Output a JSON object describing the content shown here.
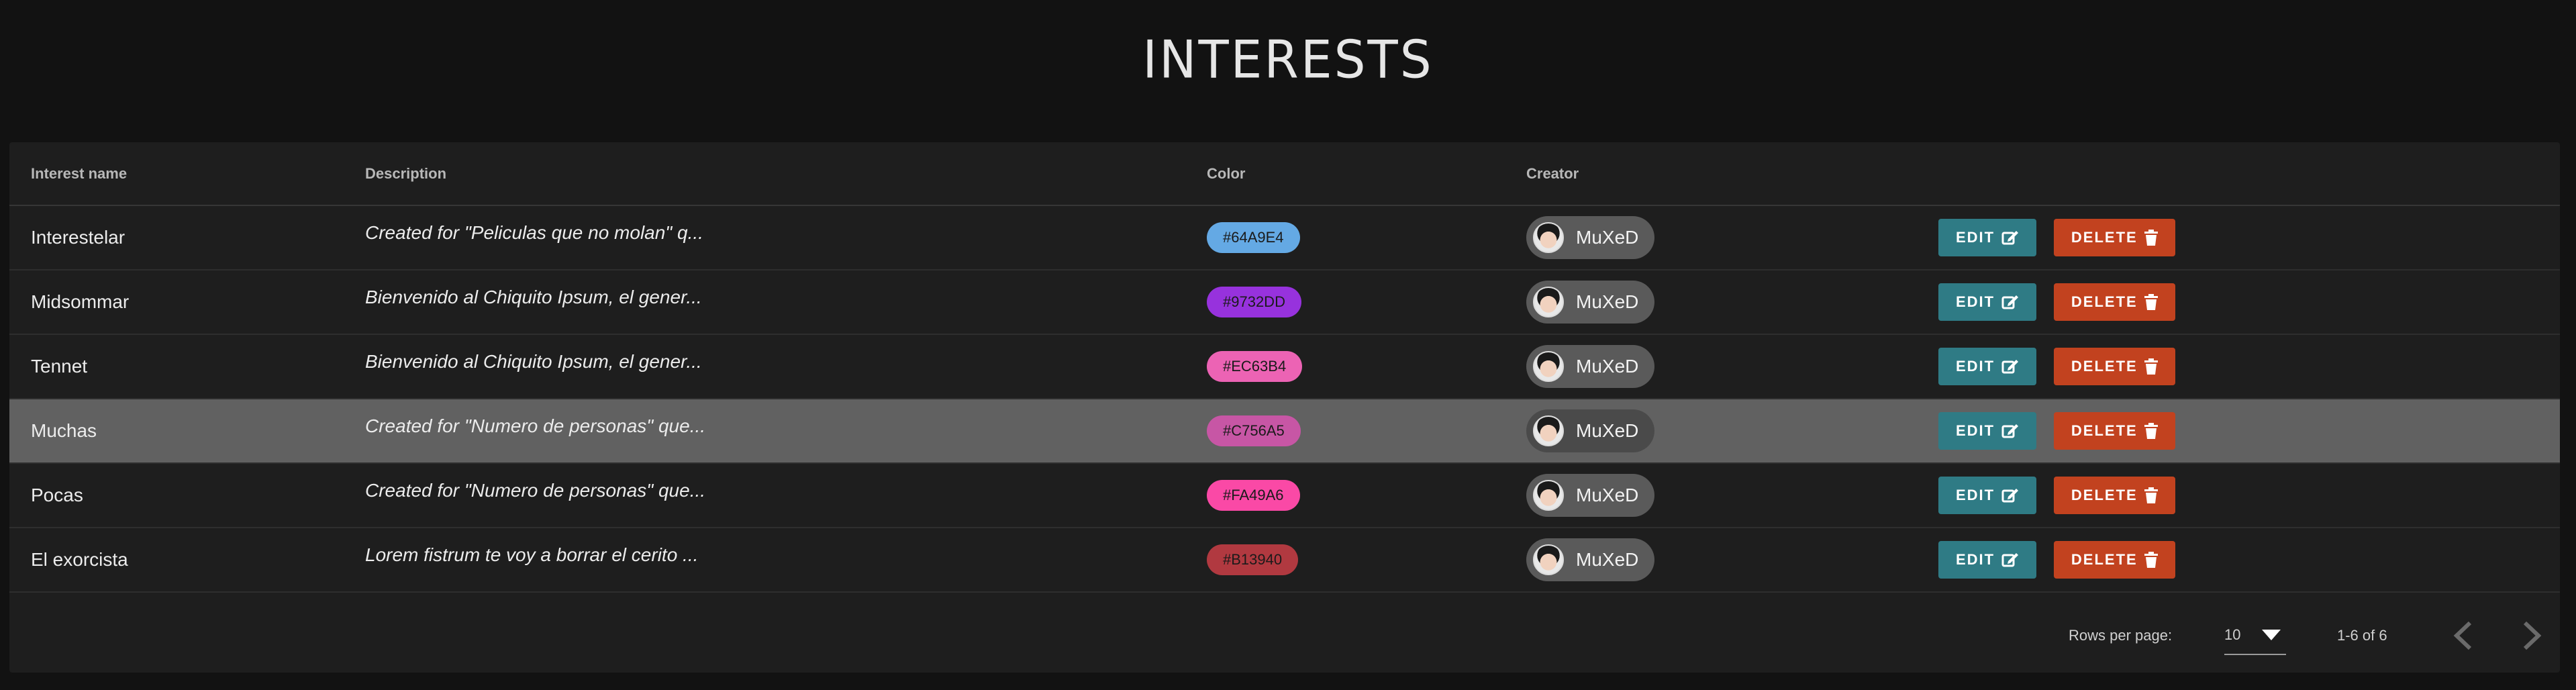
{
  "page": {
    "title": "INTERESTS"
  },
  "table": {
    "columns": [
      "Interest name",
      "Description",
      "Color",
      "Creator"
    ],
    "rows": [
      {
        "name": "Interestelar",
        "description": "Created for \"Peliculas que no molan\" q...",
        "color": "#64A9E4",
        "creator": "MuXeD",
        "edit": "EDIT",
        "delete": "DELETE"
      },
      {
        "name": "Midsommar",
        "description": "Bienvenido al Chiquito Ipsum, el gener...",
        "color": "#9732DD",
        "creator": "MuXeD",
        "edit": "EDIT",
        "delete": "DELETE"
      },
      {
        "name": "Tennet",
        "description": "Bienvenido al Chiquito Ipsum, el gener...",
        "color": "#EC63B4",
        "creator": "MuXeD",
        "edit": "EDIT",
        "delete": "DELETE"
      },
      {
        "name": "Muchas",
        "description": "Created for \"Numero de personas\" que...",
        "color": "#C756A5",
        "creator": "MuXeD",
        "edit": "EDIT",
        "delete": "DELETE",
        "selected": true
      },
      {
        "name": "Pocas",
        "description": "Created for \"Numero de personas\" que...",
        "color": "#FA49A6",
        "creator": "MuXeD",
        "edit": "EDIT",
        "delete": "DELETE"
      },
      {
        "name": "El exorcista",
        "description": "Lorem fistrum te voy a borrar el cerito ...",
        "color": "#B13940",
        "creator": "MuXeD",
        "edit": "EDIT",
        "delete": "DELETE"
      }
    ]
  },
  "pagination": {
    "rows_per_page_label": "Rows per page:",
    "rows_per_page": "10",
    "range": "1-6 of 6"
  },
  "icons": {
    "edit": "edit-icon",
    "delete": "trash-icon",
    "dropdown": "caret-down-icon",
    "prev": "chevron-left-icon",
    "next": "chevron-right-icon",
    "avatar": "avatar-icon"
  },
  "colors": {
    "background": "#121212",
    "card": "#1e1e1e",
    "selected_row": "#616161",
    "edit_button": "#2f7b85",
    "delete_button": "#c2421f"
  }
}
